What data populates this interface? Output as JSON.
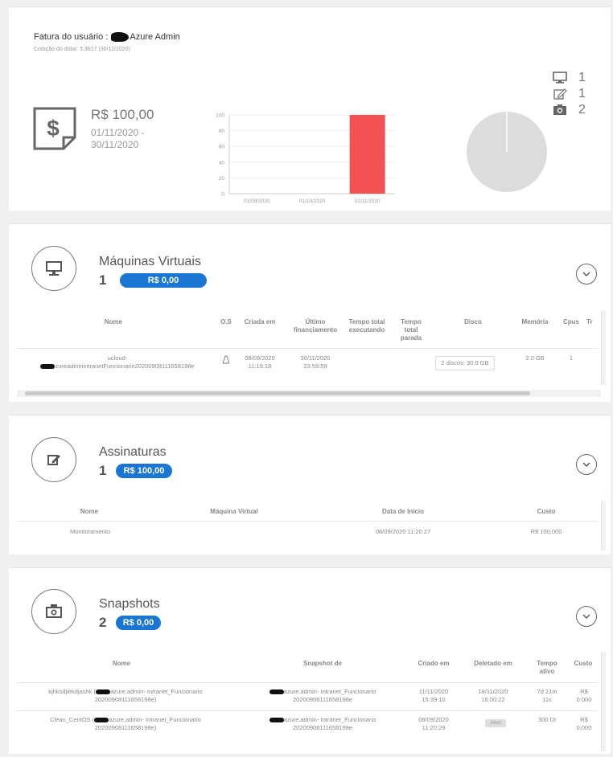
{
  "summary": {
    "title_prefix": "Fatura do usuário :",
    "title_user": "Azure Admin",
    "quote": "Cotação do dolar: 5.3817 (30/11/2020)",
    "amount": "R$ 100,00",
    "period": "01/11/2020 - 30/11/2020",
    "counts": [
      {
        "icon": "monitor-icon",
        "value": "1"
      },
      {
        "icon": "edit-icon",
        "value": "1"
      },
      {
        "icon": "snapshot-icon",
        "value": "2"
      }
    ]
  },
  "chart_data": {
    "type": "bar",
    "categories": [
      "01/09/2020",
      "01/10/2020",
      "01/11/2020"
    ],
    "values": [
      0,
      0,
      100
    ],
    "ylim": [
      0,
      100
    ],
    "yticks": [
      "100",
      "80",
      "60",
      "40",
      "20",
      "0"
    ],
    "bar_color": "#f25252"
  },
  "pie_data": {
    "type": "pie",
    "values": [
      100
    ],
    "color": "#dcdcdc"
  },
  "vms": {
    "title": "Máquinas Virtuais",
    "count": "1",
    "badge": "R$ 0,00",
    "headers": {
      "nome": "Nome",
      "os": "O.S",
      "criada": "Criada em",
      "ultimo": "Último financiamento",
      "tempo_exec": "Tempo total executando",
      "tempo_parada": "Tempo total parada",
      "disco": "Disco",
      "memoria": "Memória",
      "cpus": "Cpus",
      "tr": "Tr"
    },
    "row": {
      "nome_1": "ucloud-",
      "nome_2": "zureadminintranetFuncionario20200908111658198e",
      "criada": "08/09/2020 11:19:18",
      "ultimo": "30/11/2020 23:59:59",
      "disco": "2 discos: 30.0 GB",
      "memoria": "2.0 GB",
      "cpus": "1"
    }
  },
  "subs": {
    "title": "Assinaturas",
    "count": "1",
    "badge": "R$ 100,00",
    "headers": {
      "nome": "Nome",
      "maquina": "Máquina Virtual",
      "data": "Data de Início",
      "custo": "Custo"
    },
    "row": {
      "nome": "Monitoramento",
      "data": "08/09/2020 11:20:27",
      "custo": "R$ 100,000"
    }
  },
  "snaps": {
    "title": "Snapshots",
    "count": "2",
    "badge": "R$ 0,00",
    "headers": {
      "nome": "Nome",
      "snapshot_de": "Snapshot de",
      "criado": "Criado em",
      "deletado": "Deletado em",
      "tempo": "Tempo ativo",
      "custo": "Custo"
    },
    "rows": [
      {
        "nome_1a": "kjhksdjlekdjashk (",
        "nome_1b": "azure.admin- Intranet_Funcionario",
        "nome_2": "20200908111658198e)",
        "de_1": "azure.admin- Intranet_Funcionario",
        "de_2": "20200908111658198e",
        "criado_1": "11/11/2020",
        "criado_2": "15:39:10",
        "deletado_1": "18/11/2020",
        "deletado_2": "16:00:22",
        "tempo_1": "7d 21m",
        "tempo_2": "11s",
        "custo_1": "R$",
        "custo_2": "0.000"
      },
      {
        "nome_1a": "Clean_CentOS (",
        "nome_1b": "azure.admin- Intranet_Funcionario",
        "nome_2": "20200908111658198e)",
        "de_1": "azure.admin- Intranet_Funcionario",
        "de_2": "20200908111658198e",
        "criado_1": "08/09/2020",
        "criado_2": "11:20:29",
        "deletado_pill": "Ativo",
        "tempo_1": "300 Dt",
        "custo_1": "R$",
        "custo_2": "0.000"
      }
    ]
  }
}
